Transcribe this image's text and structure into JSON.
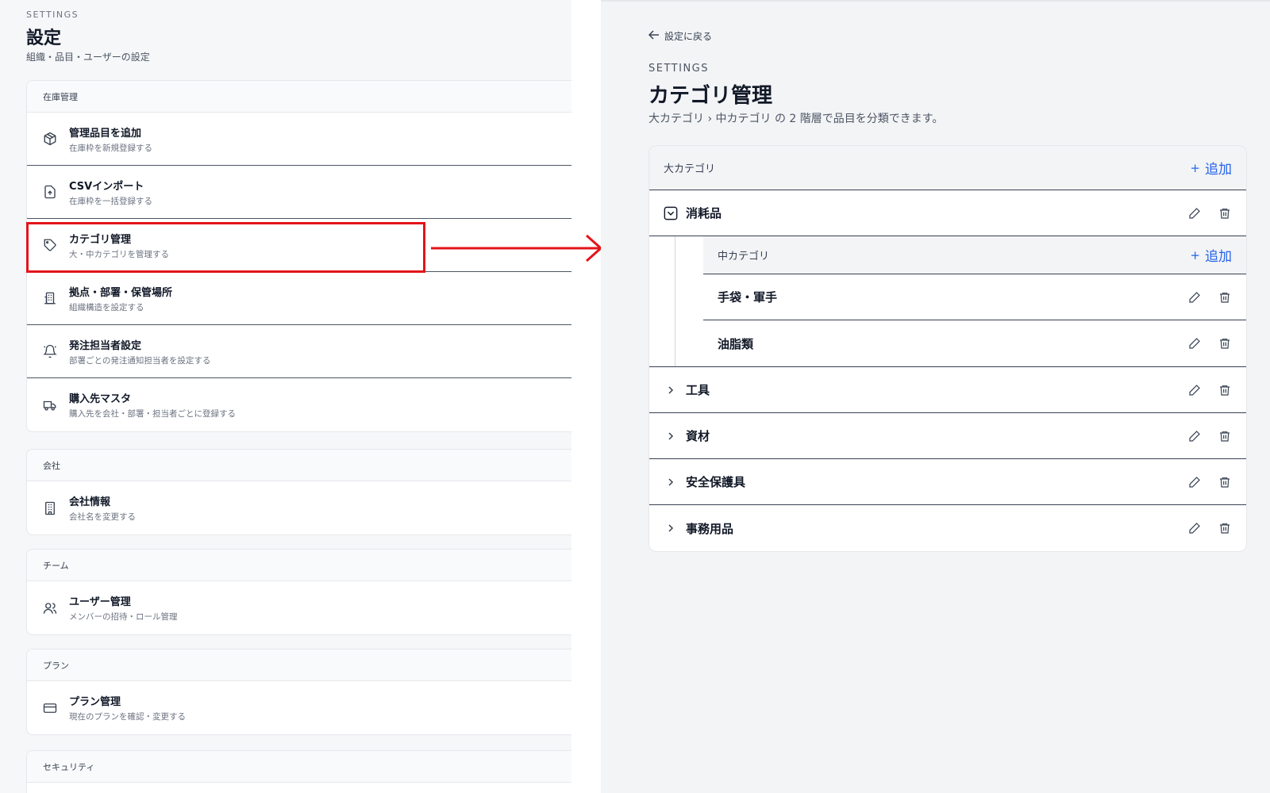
{
  "left": {
    "eyebrow": "SETTINGS",
    "title": "設定",
    "subtitle": "組織・品目・ユーザーの設定",
    "sections": [
      {
        "heading": "在庫管理",
        "items": [
          {
            "icon": "box-icon",
            "title": "管理品目を追加",
            "desc": "在庫枠を新規登録する"
          },
          {
            "icon": "file-upload-icon",
            "title": "CSVインポート",
            "desc": "在庫枠を一括登録する"
          },
          {
            "icon": "tag-icon",
            "title": "カテゴリ管理",
            "desc": "大・中カテゴリを管理する"
          },
          {
            "icon": "building-icon",
            "title": "拠点・部署・保管場所",
            "desc": "組織構造を設定する"
          },
          {
            "icon": "bell-icon",
            "title": "発注担当者設定",
            "desc": "部署ごとの発注通知担当者を設定する"
          },
          {
            "icon": "truck-icon",
            "title": "購入先マスタ",
            "desc": "購入先を会社・部署・担当者ごとに登録する"
          }
        ]
      },
      {
        "heading": "会社",
        "items": [
          {
            "icon": "office-icon",
            "title": "会社情報",
            "desc": "会社名を変更する"
          }
        ]
      },
      {
        "heading": "チーム",
        "items": [
          {
            "icon": "users-icon",
            "title": "ユーザー管理",
            "desc": "メンバーの招待・ロール管理"
          }
        ]
      },
      {
        "heading": "プラン",
        "items": [
          {
            "icon": "credit-card-icon",
            "title": "プラン管理",
            "desc": "現在のプランを確認・変更する"
          }
        ]
      },
      {
        "heading": "セキュリティ",
        "items": []
      }
    ]
  },
  "right": {
    "back_label": "設定に戻る",
    "eyebrow": "SETTINGS",
    "title": "カテゴリ管理",
    "subtitle": "大カテゴリ › 中カテゴリ の 2 階層で品目を分類できます。",
    "major_header": "大カテゴリ",
    "add_label": "追加",
    "expanded_category": "消耗品",
    "sub_header": "中カテゴリ",
    "sub_categories": [
      "手袋・軍手",
      "油脂類"
    ],
    "collapsed_categories": [
      "工具",
      "資材",
      "安全保護具",
      "事務用品"
    ]
  },
  "colors": {
    "highlight": "#e3141b",
    "accent": "#2563eb"
  }
}
